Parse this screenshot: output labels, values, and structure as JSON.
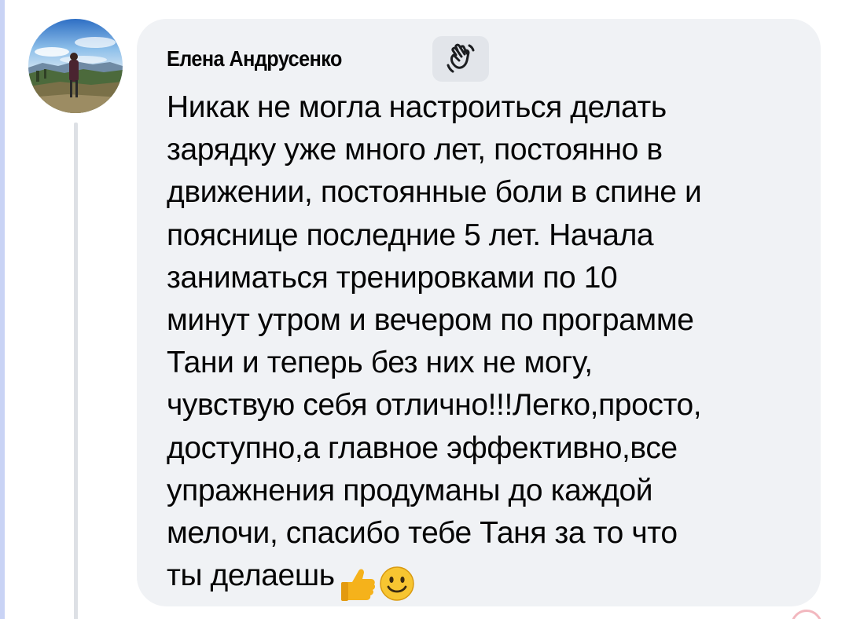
{
  "comment": {
    "author": "Елена Андрусенко",
    "badge_icon": "waving-hand-icon",
    "text": "Никак не могла настроиться делать\nзарядку уже много лет, постоянно в\nдвижении, постоянные боли в спине и\nпояснице последние 5 лет. Начала\nзаниматься  тренировками по 10\nминут утром и вечером по программе\nТани и теперь без них не могу,\nчувствую себя отлично!!!Легко,просто,\nдоступно,а главное эффективно,все\nупражнения продуманы до каждой\nмелочи, спасибо тебе Таня за то что\nты делаешь",
    "trailing_emojis": [
      "thumbs-up-icon",
      "smiling-face-icon"
    ]
  },
  "colors": {
    "bubble_bg": "#f0f2f5",
    "text": "#050505",
    "badge_bg": "#e2e5ea",
    "thread_line": "#dde0e5",
    "thumbs_up": "#f5b21b",
    "smile": "#f7c531"
  }
}
